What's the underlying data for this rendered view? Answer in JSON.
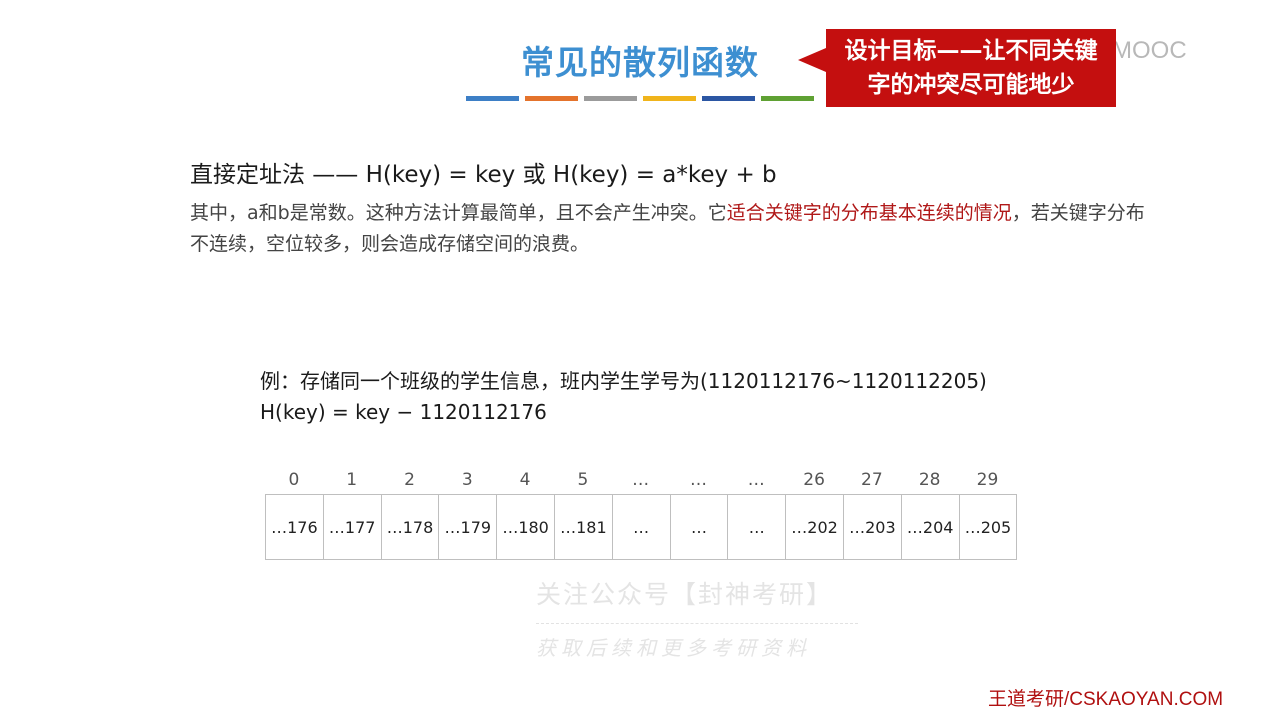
{
  "slide": {
    "title": "常见的散列函数",
    "color_bars": [
      "#3d7fc6",
      "#e4732c",
      "#9b9b9b",
      "#f0b41b",
      "#2b56a3",
      "#5fa133"
    ]
  },
  "callout": {
    "line1": "设计目标——让不同关键",
    "line2": "字的冲突尽可能地少"
  },
  "watermark_top": "国大学MOOC",
  "method": {
    "heading": "直接定址法 —— H(key) = key 或 H(key) = a*key + b",
    "desc_before": "其中，a和b是常数。这种方法计算最简单，且不会产生冲突。它",
    "desc_highlight": "适合关键字的分布基本连续的情况",
    "desc_after": "，若关键字分布不连续，空位较多，则会造成存储空间的浪费。"
  },
  "example": {
    "line1": "例：存储同一个班级的学生信息，班内学生学号为(1120112176~1120112205)",
    "line2": "H(key) = key − 1120112176"
  },
  "table": {
    "indices": [
      "0",
      "1",
      "2",
      "3",
      "4",
      "5",
      "…",
      "…",
      "…",
      "26",
      "27",
      "28",
      "29"
    ],
    "cells": [
      "…176",
      "…177",
      "…178",
      "…179",
      "…180",
      "…181",
      "…",
      "…",
      "…",
      "…202",
      "…203",
      "…204",
      "…205"
    ]
  },
  "watermark_center": {
    "line1": "关注公众号【封神考研】",
    "line2": "获取后续和更多考研资料"
  },
  "footer": "王道考研/CSKAOYAN.COM"
}
